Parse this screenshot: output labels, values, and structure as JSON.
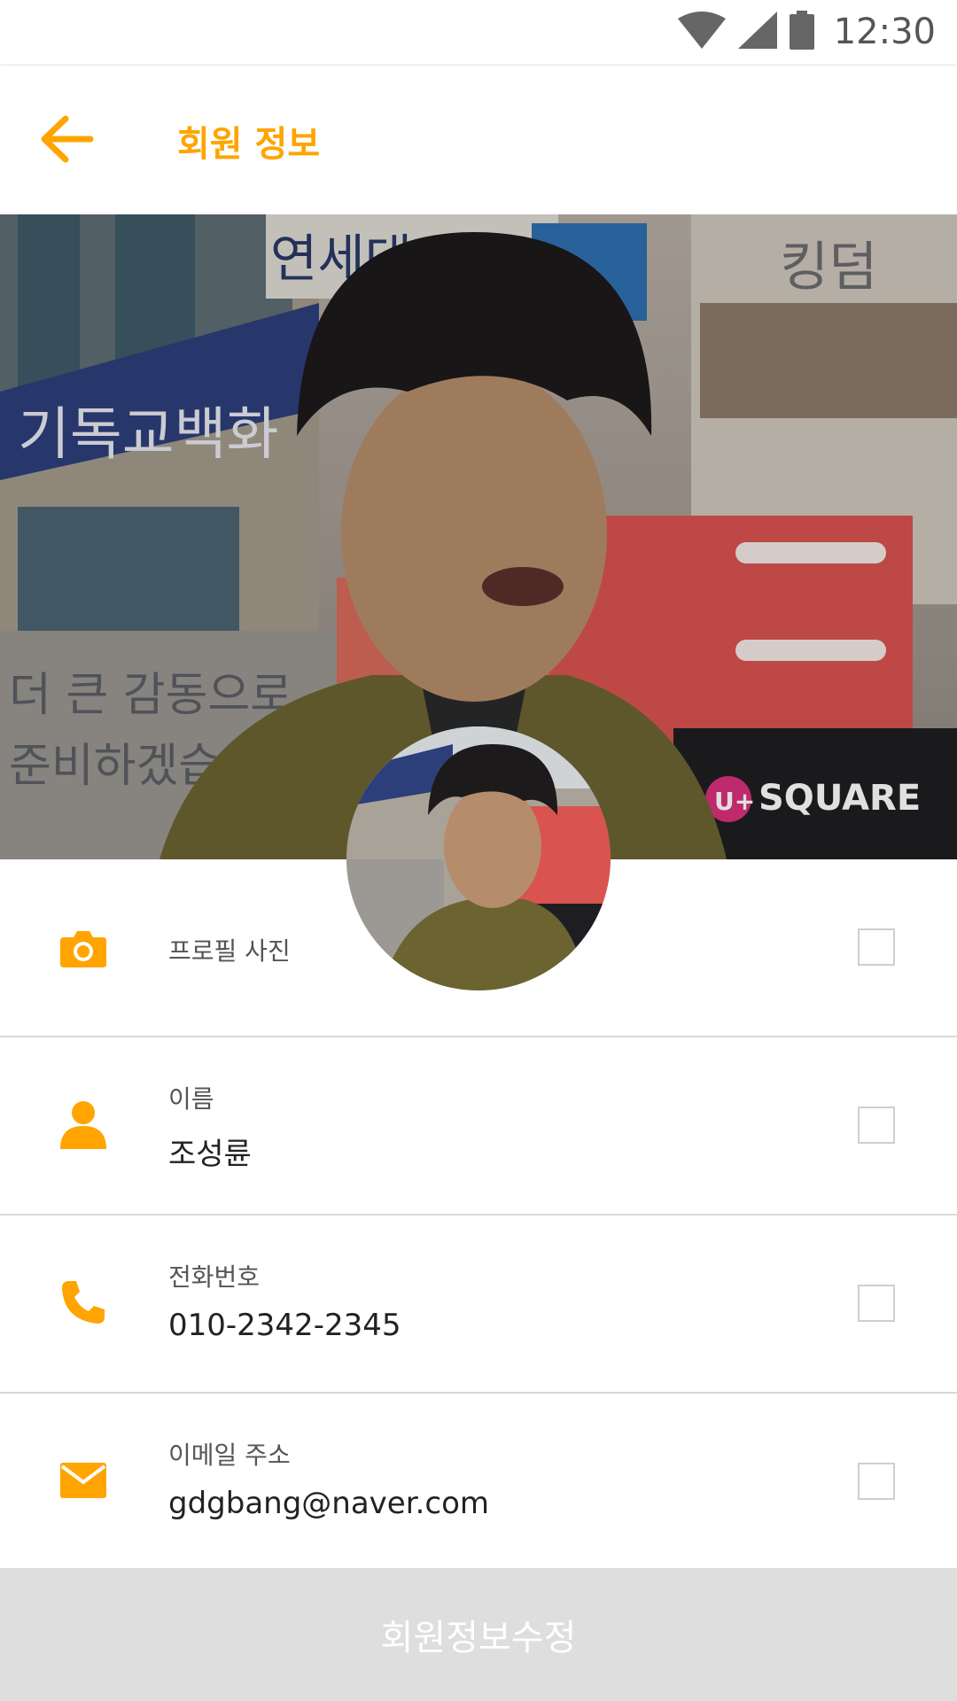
{
  "status_bar": {
    "time": "12:30"
  },
  "app_bar": {
    "title": "회원 정보"
  },
  "cover": {
    "sign_top": "연세대",
    "sign_left": "기독교백화",
    "sign_right": "킹덤",
    "banner_bottom_left": "더 큰 감동으로",
    "banner_bottom_left_2": "준비하겠습니다!",
    "store_sign": "SQUARE",
    "store_logo": "U+"
  },
  "fields": [
    {
      "label": "프로필 사진",
      "value": "",
      "icon": "camera-icon"
    },
    {
      "label": "이름",
      "value": "조성륜",
      "icon": "person-icon"
    },
    {
      "label": "전화번호",
      "value": "010-2342-2345",
      "icon": "phone-icon"
    },
    {
      "label": "이메일 주소",
      "value": "gdgbang@naver.com",
      "icon": "mail-icon"
    }
  ],
  "submit_button": {
    "label": "회원정보수정"
  },
  "colors": {
    "accent": "#FFA400",
    "divider": "#d9d9d9",
    "button_bg": "#dedede"
  }
}
